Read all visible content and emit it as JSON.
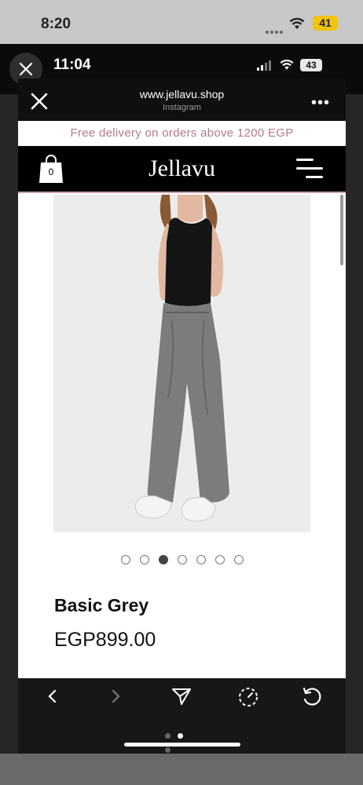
{
  "outer_status": {
    "time": "8:20",
    "battery": "41"
  },
  "inner_status": {
    "time": "11:04",
    "battery": "43"
  },
  "browser": {
    "url": "www.jellavu.shop",
    "source": "Instagram",
    "more_label": "•••"
  },
  "site": {
    "promo": "Free delivery on orders above 1200 EGP",
    "logo": "Jellavu",
    "cart_count": "0"
  },
  "product": {
    "name": "Basic Grey",
    "price": "EGP899.00",
    "gallery_count": 7,
    "gallery_active": 3
  },
  "toolbar": {
    "icons": [
      "back-arrow-icon",
      "forward-arrow-icon",
      "share-icon",
      "timer-icon",
      "refresh-icon"
    ],
    "page_dots": 3,
    "page_active": 2
  },
  "colors": {
    "promo_text": "#b5788b",
    "nav_bg": "#000000",
    "nav_border": "#c9a0a9"
  }
}
